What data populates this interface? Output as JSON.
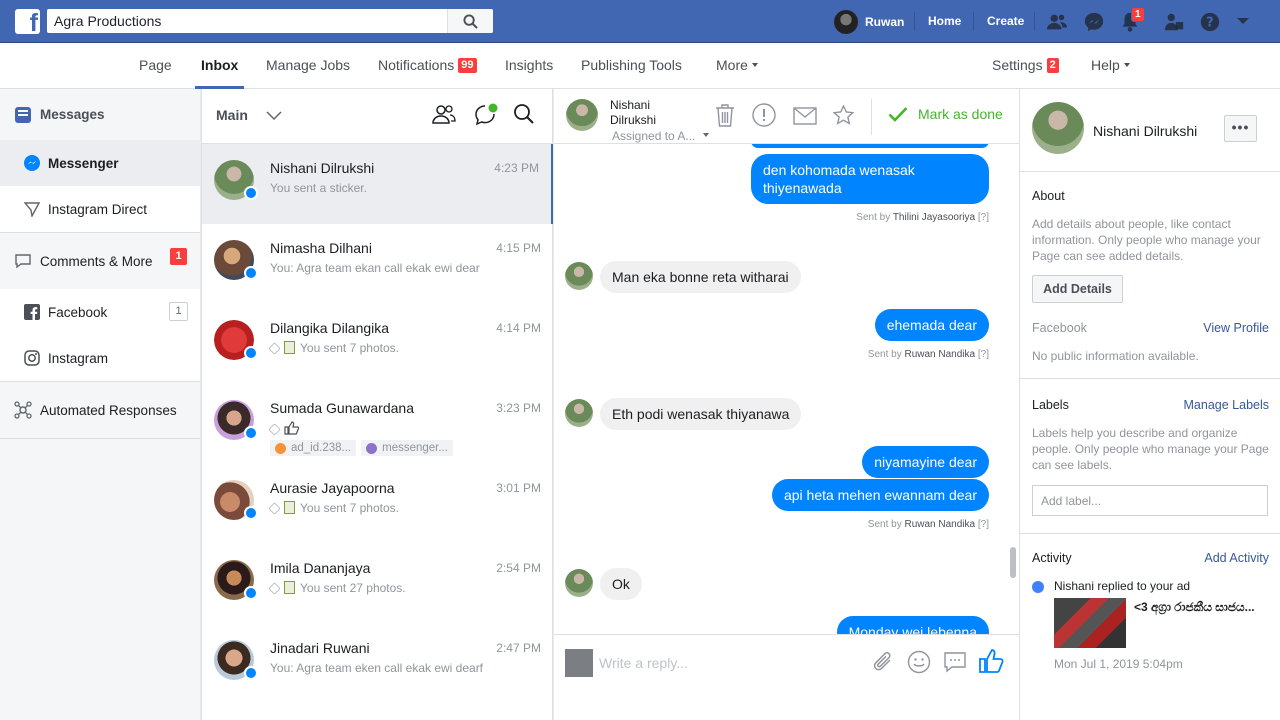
{
  "topbar": {
    "search_value": "Agra Productions",
    "user_name": "Ruwan",
    "home_label": "Home",
    "create_label": "Create",
    "notifications_count": "1",
    "brand_color": "#4267b2"
  },
  "pagenav": {
    "page": "Page",
    "inbox": "Inbox",
    "manage_jobs": "Manage Jobs",
    "notifications": "Notifications",
    "notifications_badge": "99",
    "insights": "Insights",
    "publishing_tools": "Publishing Tools",
    "more": "More",
    "settings": "Settings",
    "settings_badge": "2",
    "help": "Help"
  },
  "sidebar": {
    "messages": "Messages",
    "messenger": "Messenger",
    "instagram_direct": "Instagram Direct",
    "comments_more": "Comments & More",
    "comments_badge": "1",
    "facebook": "Facebook",
    "facebook_count": "1",
    "instagram": "Instagram",
    "automated_responses": "Automated Responses"
  },
  "convlist": {
    "title": "Main",
    "items": [
      {
        "name": "Nishani Dilrukshi",
        "time": "4:23 PM",
        "snippet": "You sent a sticker."
      },
      {
        "name": "Nimasha Dilhani",
        "time": "4:15 PM",
        "snippet": "You: Agra team ekan call ekak ewi dear"
      },
      {
        "name": "Dilangika Dilangika",
        "time": "4:14 PM",
        "snippet": "You sent 7 photos."
      },
      {
        "name": "Sumada Gunawardana",
        "time": "3:23 PM",
        "snippet": "",
        "tags": [
          "ad_id.238...",
          "messenger..."
        ]
      },
      {
        "name": "Aurasie Jayapoorna",
        "time": "3:01 PM",
        "snippet": "You sent 7 photos."
      },
      {
        "name": "Imila Dananjaya",
        "time": "2:54 PM",
        "snippet": "You sent 27 photos."
      },
      {
        "name": "Jinadari Ruwani",
        "time": "2:47 PM",
        "snippet": "You: Agra team eken call ekak ewi dearf"
      }
    ]
  },
  "chat": {
    "contact_name": "Nishani Dilrukshi",
    "assigned_to": "Assigned to A...",
    "mark_done": "Mark as done",
    "sent_by_prefix": "Sent by",
    "reply_placeholder": "Write a reply...",
    "messages": [
      {
        "dir": "out",
        "text": "den kohomada wenasak thiyenawada",
        "sent_by": "Thilini Jayasooriya"
      },
      {
        "dir": "in",
        "text": "Man eka bonne reta witharai"
      },
      {
        "dir": "out",
        "text": "ehemada dear",
        "sent_by": "Ruwan Nandika"
      },
      {
        "dir": "in",
        "text": "Eth podi wenasak thiyanawa"
      },
      {
        "dir": "out",
        "text": "niyamayine dear"
      },
      {
        "dir": "out",
        "text": "api heta mehen ewannam dear",
        "sent_by": "Ruwan Nandika"
      },
      {
        "dir": "in",
        "text": "Ok"
      },
      {
        "dir": "out",
        "text": "Monday wei lebenna"
      }
    ]
  },
  "rpanel": {
    "name": "Nishani Dilrukshi",
    "more": "•••",
    "about_title": "About",
    "about_text": "Add details about people, like contact information. Only people who manage your Page can see added details.",
    "add_details": "Add Details",
    "facebook": "Facebook",
    "view_profile": "View Profile",
    "no_info": "No public information available.",
    "labels_title": "Labels",
    "manage_labels": "Manage Labels",
    "labels_text": "Labels help you describe and organize people. Only people who manage your Page can see labels.",
    "add_label_placeholder": "Add label...",
    "activity_title": "Activity",
    "add_activity": "Add Activity",
    "activity_text": "Nishani replied to your ad",
    "activity_ad": "<3 අග්‍රා රාජකීය සාජය...",
    "activity_date": "Mon Jul 1, 2019 5:04pm"
  }
}
